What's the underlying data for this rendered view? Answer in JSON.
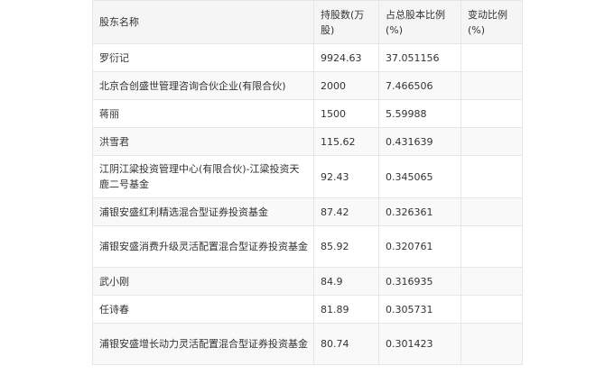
{
  "table": {
    "headers": [
      "股东名称",
      "持股数(万股)",
      "占总股本比例(%)",
      "变动比例(%)"
    ],
    "rows": [
      {
        "name": "罗衍记",
        "shares": "9924.63",
        "ratio": "37.051156",
        "change": ""
      },
      {
        "name": "北京合创盛世管理咨询合伙企业(有限合伙)",
        "shares": "2000",
        "ratio": "7.466506",
        "change": ""
      },
      {
        "name": "蒋丽",
        "shares": "1500",
        "ratio": "5.59988",
        "change": ""
      },
      {
        "name": "洪雪君",
        "shares": "115.62",
        "ratio": "0.431639",
        "change": ""
      },
      {
        "name": "江阴江粱投资管理中心(有限合伙)-江粱投资天鹿二号基金",
        "shares": "92.43",
        "ratio": "0.345065",
        "change": ""
      },
      {
        "name": "浦银安盛红利精选混合型证券投资基金",
        "shares": "87.42",
        "ratio": "0.326361",
        "change": ""
      },
      {
        "name": "浦银安盛消费升级灵活配置混合型证券投资基金",
        "shares": "85.92",
        "ratio": "0.320761",
        "change": ""
      },
      {
        "name": "武小刚",
        "shares": "84.9",
        "ratio": "0.316935",
        "change": ""
      },
      {
        "name": "任诗春",
        "shares": "81.89",
        "ratio": "0.305731",
        "change": ""
      },
      {
        "name": "浦银安盛增长动力灵活配置混合型证券投资基金",
        "shares": "80.74",
        "ratio": "0.301423",
        "change": ""
      }
    ]
  }
}
